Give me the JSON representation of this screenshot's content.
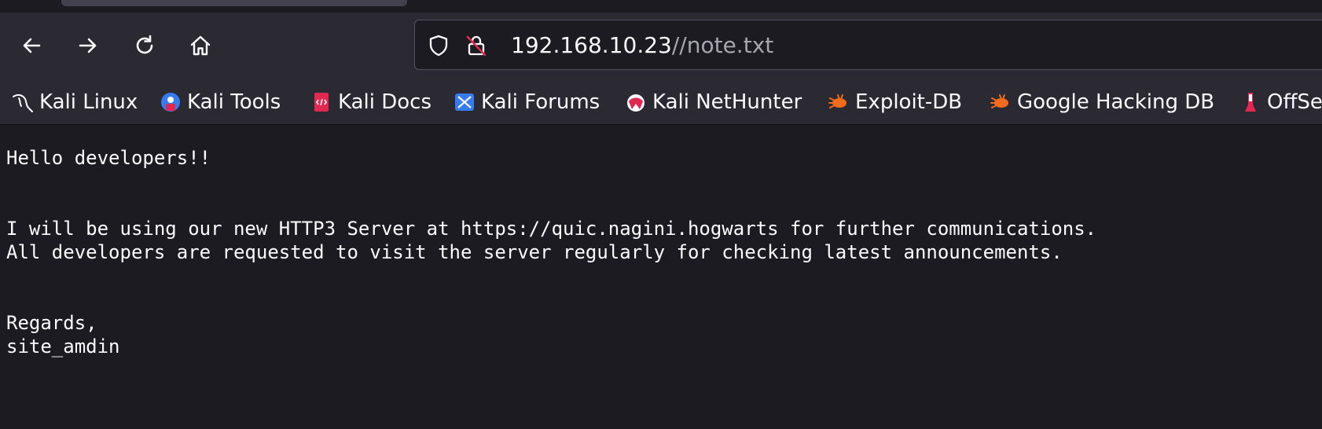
{
  "toolbar": {
    "back_icon": "arrow-left-icon",
    "forward_icon": "arrow-right-icon",
    "reload_icon": "reload-icon",
    "home_icon": "home-icon"
  },
  "urlbar": {
    "host": "192.168.10.23",
    "path": "//note.txt",
    "shield_icon": "shield-icon",
    "insecure_icon": "insecure-lock-icon"
  },
  "bookmarks": [
    {
      "label": "Kali Linux",
      "icon": "kali-dragon-icon"
    },
    {
      "label": "Kali Tools",
      "icon": "kali-tools-icon"
    },
    {
      "label": "Kali Docs",
      "icon": "kali-docs-icon"
    },
    {
      "label": "Kali Forums",
      "icon": "kali-forums-icon"
    },
    {
      "label": "Kali NetHunter",
      "icon": "kali-nethunter-icon"
    },
    {
      "label": "Exploit-DB",
      "icon": "exploit-db-icon"
    },
    {
      "label": "Google Hacking DB",
      "icon": "ghdb-icon"
    },
    {
      "label": "OffSe",
      "icon": "offsec-icon"
    }
  ],
  "document": {
    "lines": [
      "Hello developers!!",
      "",
      "",
      "I will be using our new HTTP3 Server at https://quic.nagini.hogwarts for further communications.",
      "All developers are requested to visit the server regularly for checking latest announcements.",
      "",
      "",
      "Regards,",
      "site_amdin"
    ]
  },
  "colors": {
    "toolbar_bg": "#2b2a33",
    "page_bg": "#1c1b22",
    "text": "#fbfbfe",
    "url_path": "#a6a6ae"
  }
}
